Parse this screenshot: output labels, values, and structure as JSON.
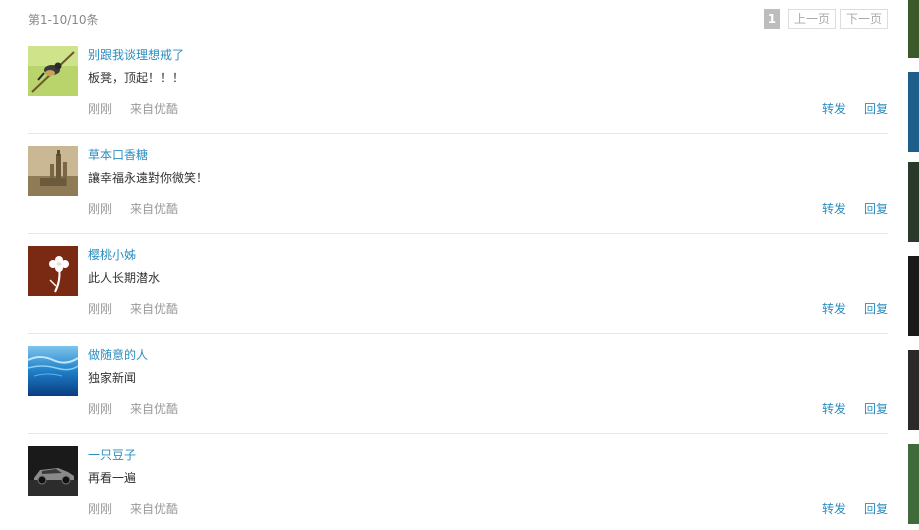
{
  "header": {
    "count_text": "第1-10/10条",
    "pager": {
      "current_page": "1",
      "prev_label": "上一页",
      "next_label": "下一页"
    }
  },
  "feed": {
    "items": [
      {
        "username": "别跟我谈理想戒了",
        "content": "板凳，顶起！！！",
        "time": "刚刚",
        "source": "来自优酷",
        "forward_label": "转发",
        "reply_label": "回复",
        "avatar_icon": "bird-on-branch-photo"
      },
      {
        "username": "草本口香糖",
        "content": "讓幸福永遠對你微笑！",
        "time": "刚刚",
        "source": "来自优酷",
        "forward_label": "转发",
        "reply_label": "回复",
        "avatar_icon": "tower-photo"
      },
      {
        "username": "樱桃小姊",
        "content": "此人长期潜水",
        "time": "刚刚",
        "source": "来自优酷",
        "forward_label": "转发",
        "reply_label": "回复",
        "avatar_icon": "white-flower-photo"
      },
      {
        "username": "做随意的人",
        "content": "独家新闻",
        "time": "刚刚",
        "source": "来自优酷",
        "forward_label": "转发",
        "reply_label": "回复",
        "avatar_icon": "ocean-photo"
      },
      {
        "username": "一只豆子",
        "content": "再看一遍",
        "time": "刚刚",
        "source": "来自优酷",
        "forward_label": "转发",
        "reply_label": "回复",
        "avatar_icon": "car-photo"
      }
    ]
  },
  "colors": {
    "link": "#2b8dbf",
    "muted": "#999999",
    "text": "#333333",
    "divider": "#e6e6e6"
  }
}
